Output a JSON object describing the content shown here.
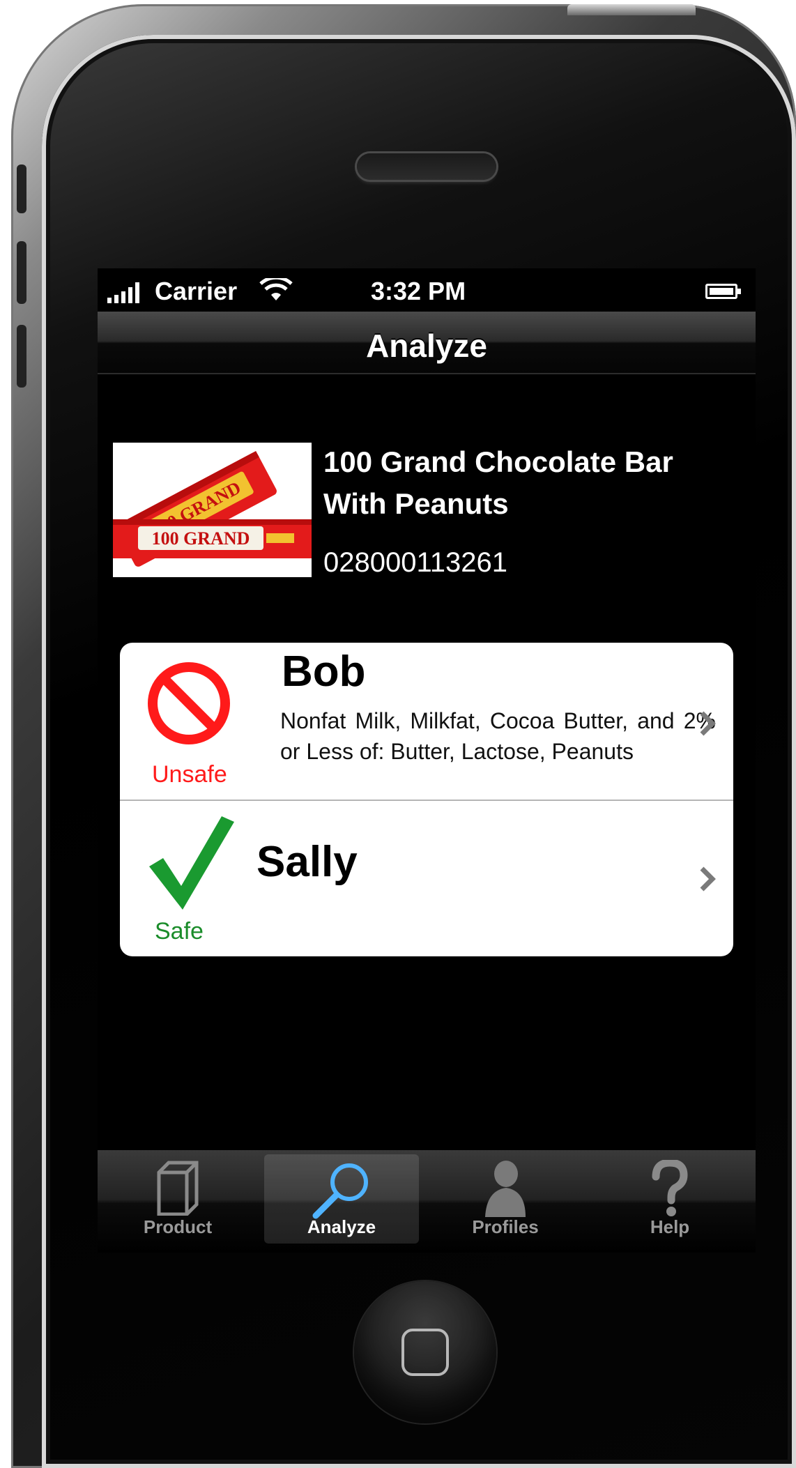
{
  "status_bar": {
    "carrier": "Carrier",
    "time": "3:32 PM"
  },
  "nav": {
    "title": "Analyze"
  },
  "product": {
    "name_line1": "100 Grand Chocolate Bar",
    "name_line2": "With Peanuts",
    "upc": "028000113261",
    "image_brand_text": "100 GRAND"
  },
  "profiles": [
    {
      "name": "Bob",
      "status": "Unsafe",
      "status_icon": "prohibited-icon",
      "status_color": "#ff1a1a",
      "ingredients": "Nonfat Milk, Milkfat, Cocoa Butter, and 2% or Less of: Butter, Lactose, Peanuts"
    },
    {
      "name": "Sally",
      "status": "Safe",
      "status_icon": "checkmark-icon",
      "status_color": "#1a8c2a",
      "ingredients": ""
    }
  ],
  "tabs": [
    {
      "label": "Product",
      "icon": "box-icon",
      "active": false
    },
    {
      "label": "Analyze",
      "icon": "magnifier-icon",
      "active": true
    },
    {
      "label": "Profiles",
      "icon": "person-icon",
      "active": false
    },
    {
      "label": "Help",
      "icon": "question-icon",
      "active": false
    }
  ],
  "colors": {
    "accent_active_tab": "#4fb3ff",
    "unsafe": "#ff1a1a",
    "safe": "#1a8c2a"
  }
}
